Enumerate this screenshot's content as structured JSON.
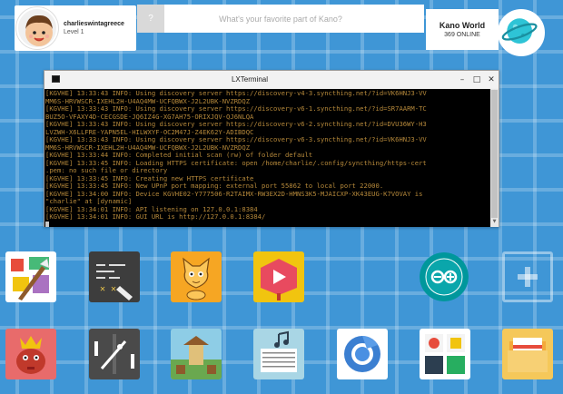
{
  "profile": {
    "username": "charlieswintagreece",
    "level": "Level 1"
  },
  "search": {
    "button_label": "?",
    "placeholder": "What's your favorite part of Kano?"
  },
  "world": {
    "title": "Kano World",
    "status": "369 ONLINE"
  },
  "terminal": {
    "title": "LXTerminal",
    "lines": [
      "[KGVHE] 13:33:43 INFO: Using discovery server https://discovery-v4-3.syncthing.net/?id=VK6HNJ3-VV",
      "MM6S-HRVWSCR-IXEHL2H-U4AQ4MW-UCFQBWX-J2L2UBK-NVZRDQZ",
      "[KGVHE] 13:33:43 INFO: Using discovery server https://discovery-v6-1.syncthing.net/?id=SR7AARM-TC",
      "BUZ5O-VFAXY4D-CECGSDE-JQ6IZ4G-XG7AH75-ORIXJQV-QJ6NLQA",
      "[KGVHE] 13:33:43 INFO: Using discovery server https://discovery-v6-2.syncthing.net/?id=DVU36WY-H3",
      "LVZWH-X6LLFRE-YAPN5EL-HILWXYF-OC2M47J-Z4EK62Y-ADIBDQC",
      "[KGVHE] 13:33:43 INFO: Using discovery server https://discovery-v6-3.syncthing.net/?id=VK6HNJ3-VV",
      "MM6S-HRVWSCR-IXEHL2H-U4AQ4MW-UCFQBWX-J2L2UBK-NVZRDQZ",
      "[KGVHE] 13:33:44 INFO: Completed initial scan (rw) of folder default",
      "[KGVHE] 13:33:45 INFO: Loading HTTPS certificate: open /home/charlie/.config/syncthing/https-cert",
      ".pem: no such file or directory",
      "[KGVHE] 13:33:45 INFO: Creating new HTTPS certificate",
      "[KGVHE] 13:33:45 INFO: New UPnP port mapping: external port 55862 to local port 22000.",
      "[KGVHE] 13:34:00 INFO: Device KGVHE02-Y777506-R2TAIMX-RW3EX2D-HMNS3K5-MJAICXP-XK43EUG-K7VOVAY is",
      "\"charlie\" at [dynamic]",
      "[KGVHE] 13:34:01 INFO: API listening on 127.0.0.1:8384",
      "[KGVHE] 13:34:01 INFO: GUI URL is http://127.0.0.1:8384/"
    ]
  },
  "apps": [
    {
      "name": "make-art-app"
    },
    {
      "name": "terminal-quest-app"
    },
    {
      "name": "scratch-app"
    },
    {
      "name": "youtube-app"
    },
    {
      "name": "arduino-app"
    },
    {
      "name": "add-app"
    },
    {
      "name": "make-snake-app"
    },
    {
      "name": "make-pong-app"
    },
    {
      "name": "make-minecraft-app"
    },
    {
      "name": "music-app"
    },
    {
      "name": "chromium-app"
    },
    {
      "name": "apps-folder"
    },
    {
      "name": "files-app"
    }
  ]
}
